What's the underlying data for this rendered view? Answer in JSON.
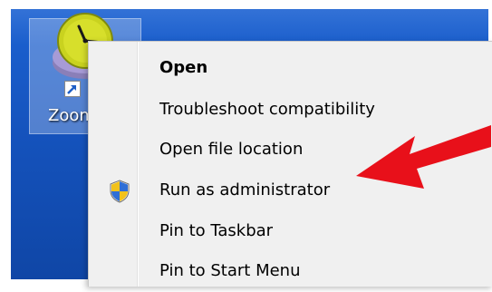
{
  "desktop": {
    "shortcut": {
      "label": "Zoom",
      "icon": "zoom-clock-icon",
      "overlay_icon": "shortcut-arrow-icon"
    }
  },
  "context_menu": {
    "items": [
      {
        "label": "Open",
        "bold": true
      },
      {
        "label": "Troubleshoot compatibility",
        "bold": false
      },
      {
        "label": "Open file location",
        "bold": false
      },
      {
        "label": "Run as administrator",
        "bold": false,
        "icon": "uac-shield-icon"
      },
      {
        "label": "Pin to Taskbar",
        "bold": false
      },
      {
        "label": "Pin to Start Menu",
        "bold": false
      }
    ]
  },
  "annotation": {
    "icon": "red-arrow-icon",
    "color": "#e8101a"
  },
  "colors": {
    "desktop": "#1553bd",
    "menu_background": "#f0f0f0"
  }
}
